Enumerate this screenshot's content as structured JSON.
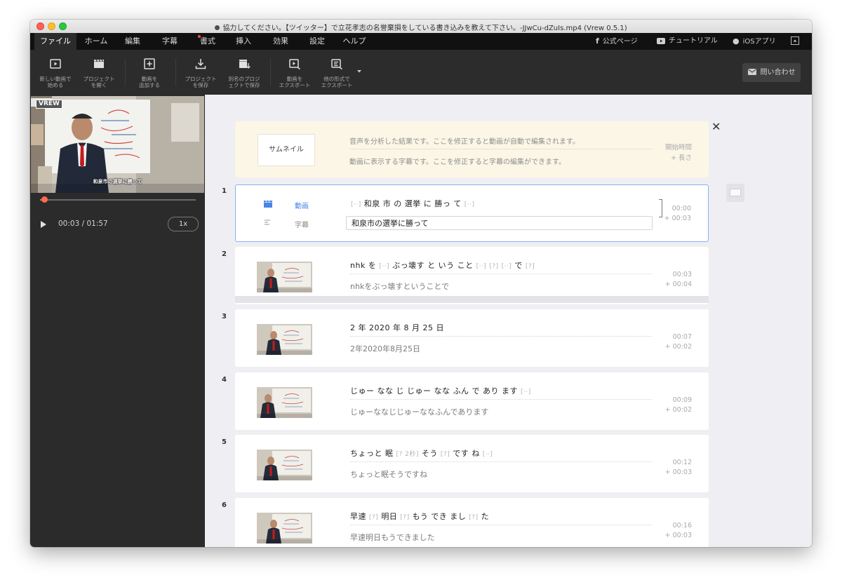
{
  "window": {
    "title": "協力してください。【ツイッター】で立花孝志の名誉棄損をしている書き込みを教えて下さい。-JJwCu-dZuIs.mp4 (Vrew 0.5.1)"
  },
  "menu": {
    "items": [
      {
        "label": "ファイル"
      },
      {
        "label": "ホーム"
      },
      {
        "label": "編集"
      },
      {
        "label": "字幕"
      },
      {
        "label": "書式"
      },
      {
        "label": "挿入"
      },
      {
        "label": "効果"
      },
      {
        "label": "設定"
      },
      {
        "label": "ヘルプ"
      }
    ],
    "active_index": 0,
    "right": {
      "official": "公式ページ",
      "tutorial": "チュートリアル",
      "ios": "iOSアプリ"
    }
  },
  "toolbar": {
    "buttons": [
      {
        "label": "新しい動画で\n始める",
        "icon": "new-video-icon"
      },
      {
        "label": "プロジェクト\nを開く",
        "icon": "clapboard-icon"
      },
      {
        "label": "動画を\n追加する",
        "icon": "add-icon"
      },
      {
        "label": "プロジェクト\nを保存",
        "icon": "download-icon"
      },
      {
        "label": "別名のプロジ\nェクトで保存",
        "icon": "save-as-icon"
      },
      {
        "label": "動画を\nエクスポート",
        "icon": "export-video-icon"
      },
      {
        "label": "他の形式で\nエクスポート",
        "icon": "export-other-icon"
      }
    ],
    "contact": "問い合わせ"
  },
  "player": {
    "time": "00:03 / 01:57",
    "speed": "1x",
    "progress_fraction": 0.027,
    "caption": "和泉市の選挙に勝って",
    "logo": "VREW"
  },
  "header": {
    "thumbnail_label": "サムネイル",
    "line1": "音声を分析した結果です。ここを修正すると動画が自動で編集されます。",
    "line2": "動画に表示する字幕です。ここを修正すると字幕の編集ができます。",
    "time_label": "開始時間",
    "length_label": "+ 長さ"
  },
  "clips": [
    {
      "num": "1",
      "selected": true,
      "video_label": "動画",
      "subtitle_label": "字幕",
      "tokens": [
        "[··]",
        "和泉",
        "市",
        "の",
        "選挙",
        "に",
        "勝っ",
        "て",
        "[··]"
      ],
      "subtitle": "和泉市の選挙に勝って",
      "start": "00:00",
      "length": "+ 00:03"
    },
    {
      "num": "2",
      "tokens": [
        "nhk",
        "を",
        "[··]",
        "ぶっ壊す",
        "と",
        "いう",
        "こと",
        "[··]",
        "[?]",
        "[··]",
        "で",
        "[?]"
      ],
      "subtitle": "nhkをぶっ壊すということで",
      "start": "00:03",
      "length": "+ 00:04"
    },
    {
      "num": "3",
      "tokens": [
        "2",
        "年",
        "2020",
        "年",
        "8",
        "月",
        "25",
        "日"
      ],
      "subtitle": "2年2020年8月25日",
      "start": "00:07",
      "length": "+ 00:02"
    },
    {
      "num": "4",
      "tokens": [
        "じゅー",
        "なな",
        "じ",
        "じゅー",
        "なな",
        "ふん",
        "で",
        "あり",
        "ます",
        "[··]"
      ],
      "subtitle": "じゅーななじじゅーななふんであります",
      "start": "00:09",
      "length": "+ 00:02"
    },
    {
      "num": "5",
      "tokens": [
        "ちょっと",
        "眠",
        "[? 2秒]",
        "そう",
        "[?]",
        "です",
        "ね",
        "[··]"
      ],
      "subtitle": "ちょっと眠そうですね",
      "start": "00:12",
      "length": "+ 00:03"
    },
    {
      "num": "6",
      "tokens": [
        "早速",
        "[?]",
        "明日",
        "[?]",
        "もう",
        "でき",
        "まし",
        "[?]",
        "た"
      ],
      "subtitle": "早速明日もうできました",
      "start": "00:16",
      "length": "+ 00:03"
    }
  ],
  "colors": {
    "accent_blue": "#4b84e8",
    "progress_red": "#ff6b4e",
    "header_bg": "#fbf6e6",
    "dark_panel": "#2b2b2b"
  }
}
